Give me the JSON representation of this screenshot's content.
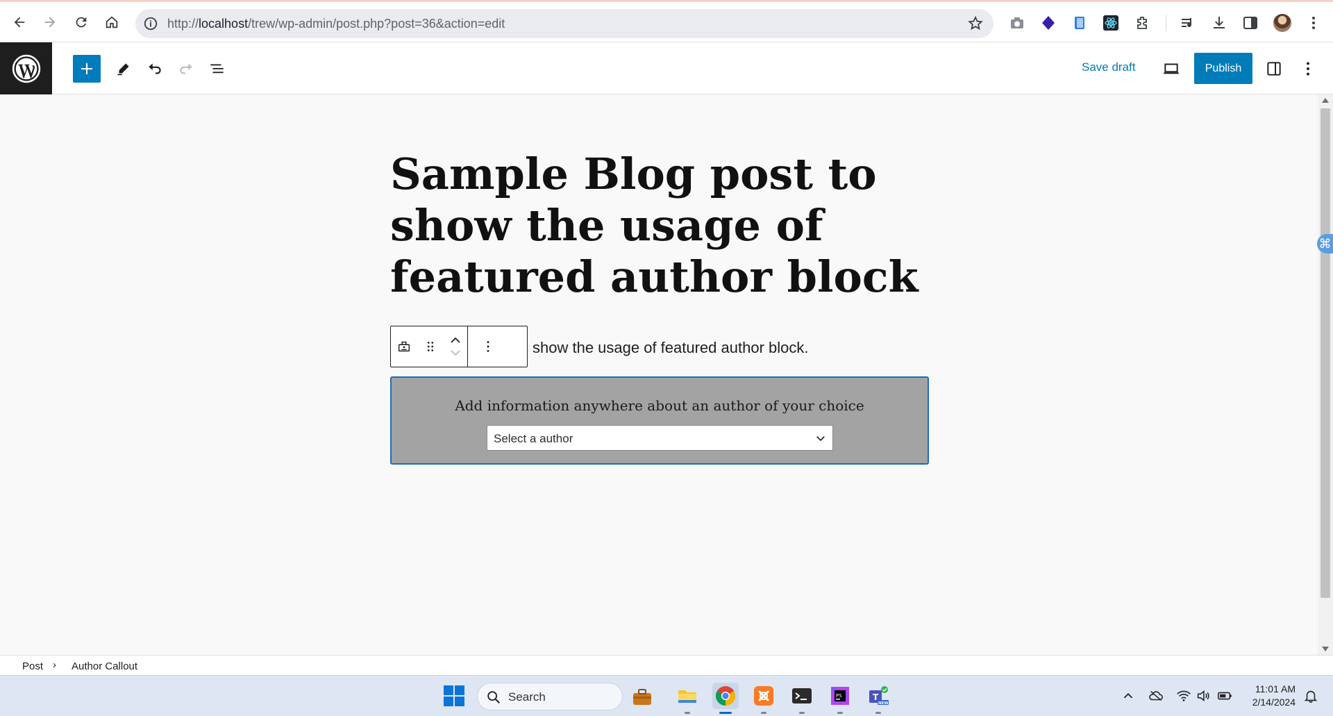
{
  "browser": {
    "url_prefix": "http://",
    "url_host": "localhost",
    "url_path": "/trew/wp-admin/post.php?post=36&action=edit"
  },
  "toolbar": {
    "save_draft_label": "Save draft",
    "publish_label": "Publish"
  },
  "post": {
    "title": "Sample Blog post to show the usage of featured author block",
    "paragraph_text": "show the usage of featured author block."
  },
  "author_block": {
    "heading": "Add information anywhere about an author of your choice",
    "select_value": "Select a author"
  },
  "breadcrumb": {
    "root": "Post",
    "current": "Author Callout"
  },
  "taskbar": {
    "search_label": "Search",
    "time": "11:01 AM",
    "date": "2/14/2024"
  },
  "colors": {
    "wp_accent": "#007cba",
    "block_background": "#a3a3a3",
    "block_border": "#1e6bb8",
    "wp_logo_bg": "#1e1e1e"
  },
  "icons": [
    "back-icon",
    "forward-icon",
    "reload-icon",
    "home-icon",
    "info-icon",
    "star-icon",
    "camera-icon",
    "extension-icon",
    "wordpress-logo",
    "plus-icon",
    "pencil-icon",
    "undo-icon",
    "redo-icon",
    "list-view-icon",
    "desktop-preview-icon",
    "settings-sidebar-icon",
    "more-options-icon",
    "block-type-icon",
    "drag-handle-icon",
    "move-up-icon",
    "move-down-icon",
    "chevron-down-icon",
    "windows-start-icon",
    "search-icon"
  ]
}
